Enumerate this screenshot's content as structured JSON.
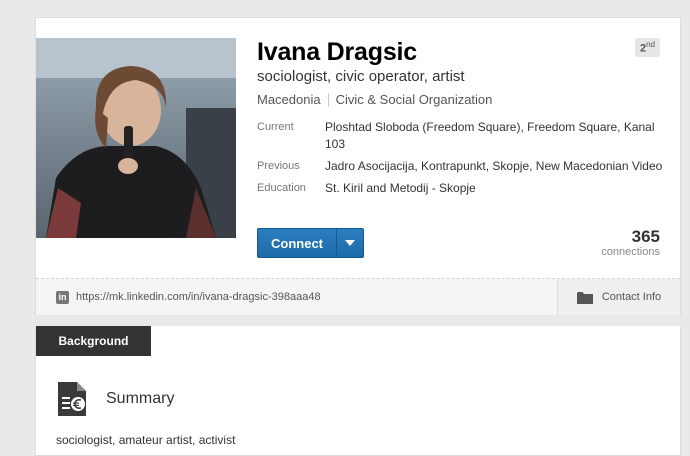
{
  "profile": {
    "name": "Ivana Dragsic",
    "headline": "sociologist, civic operator, artist",
    "location": "Macedonia",
    "industry": "Civic & Social Organization",
    "degree": "2",
    "degree_suffix": "nd",
    "rows": [
      {
        "label": "Current",
        "value": "Ploshtad Sloboda (Freedom Square), Freedom Square, Kanal 103"
      },
      {
        "label": "Previous",
        "value": "Jadro Asocijacija, Kontrapunkt, Skopje, New Macedonian Video"
      },
      {
        "label": "Education",
        "value": "St. Kiril and Metodij - Skopje"
      }
    ],
    "connect_label": "Connect",
    "connections_count": "365",
    "connections_label": "connections",
    "url": "https://mk.linkedin.com/in/ivana-dragsic-398aaa48",
    "contact_info_label": "Contact Info",
    "linkedin_icon_letters": "in"
  },
  "background": {
    "tab_label": "Background",
    "summary_title": "Summary",
    "summary_text": "sociologist, amateur artist, activist"
  },
  "icons": {
    "photo": "profile-photo",
    "dropdown": "caret-down-icon",
    "linkedin": "linkedin-icon",
    "contact": "folder-icon",
    "summary": "document-icon"
  },
  "colors": {
    "connect_button": "#2274b8",
    "background_tab": "#333333",
    "page_background": "#e9e9e9"
  }
}
